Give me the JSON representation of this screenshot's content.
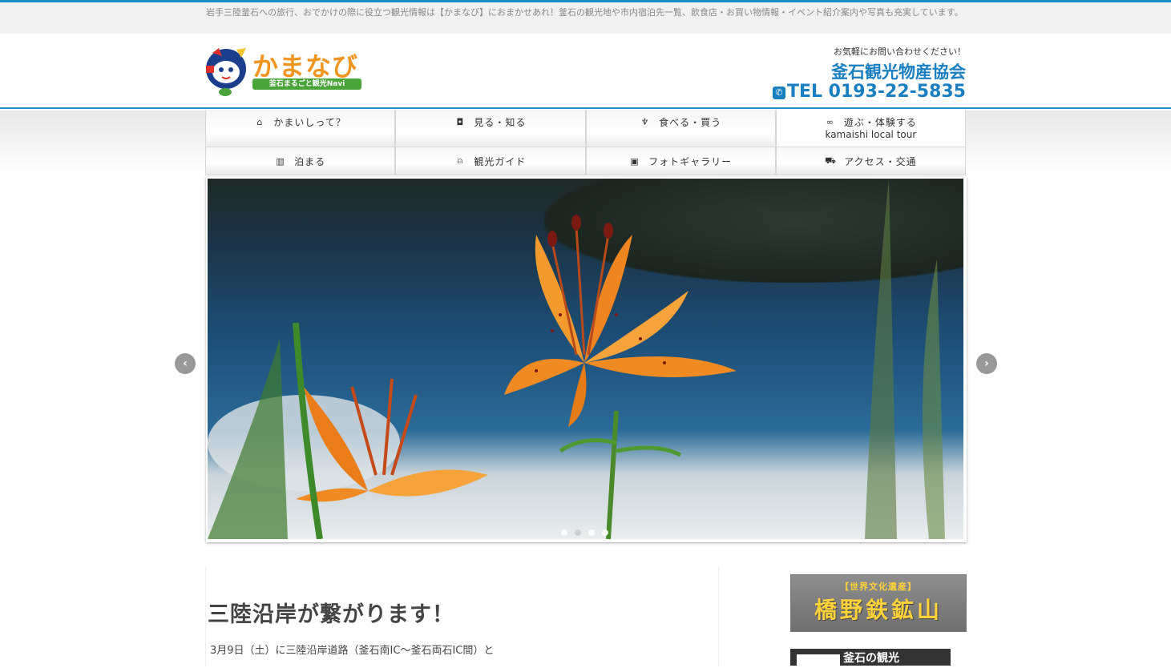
{
  "tagline": "岩手三陸釜石への旅行、おでかけの際に役立つ観光情報は【かまなび】におまかせあれ！釜石の観光地や市内宿泊先一覧、飲食店・お買い物情報・イベント紹介案内や写真も充実しています。",
  "logo": {
    "text": "かまなび",
    "sub": "釜石まるごと観光Navi"
  },
  "contact": {
    "small": "お気軽にお問い合わせください！",
    "org": "釜石観光物産協会",
    "tel": "TEL 0193-22-5835"
  },
  "nav": [
    {
      "icon": "home-icon",
      "glyph": "⌂",
      "label": "かまいしって？"
    },
    {
      "icon": "camera-icon",
      "glyph": "◘",
      "label": "見る・知る"
    },
    {
      "icon": "cutlery-icon",
      "glyph": "♆",
      "label": "食べる・買う"
    },
    {
      "icon": "bicycle-icon",
      "glyph": "∞",
      "label": "遊ぶ・体験する",
      "sub": "kamaishi local tour"
    },
    {
      "icon": "building-icon",
      "glyph": "▥",
      "label": "泊まる"
    },
    {
      "icon": "binoculars-icon",
      "glyph": "⍝",
      "label": "観光ガイド"
    },
    {
      "icon": "image-icon",
      "glyph": "▣",
      "label": "フォトギャラリー"
    },
    {
      "icon": "car-icon",
      "glyph": "⛟",
      "label": "アクセス・交通"
    }
  ],
  "slider": {
    "prev": "‹",
    "next": "›",
    "slide_count": 4,
    "active_slide": 2
  },
  "post": {
    "title": "三陸沿岸が繋がります！",
    "body": "3月9日（土）に三陸沿岸道路（釜石南IC～釜石両石IC間）と"
  },
  "sidebar": {
    "banner1_top": "【世界文化遺産】",
    "banner1_main": "橋野鉄鉱山",
    "banner2": "釜石の観光"
  }
}
